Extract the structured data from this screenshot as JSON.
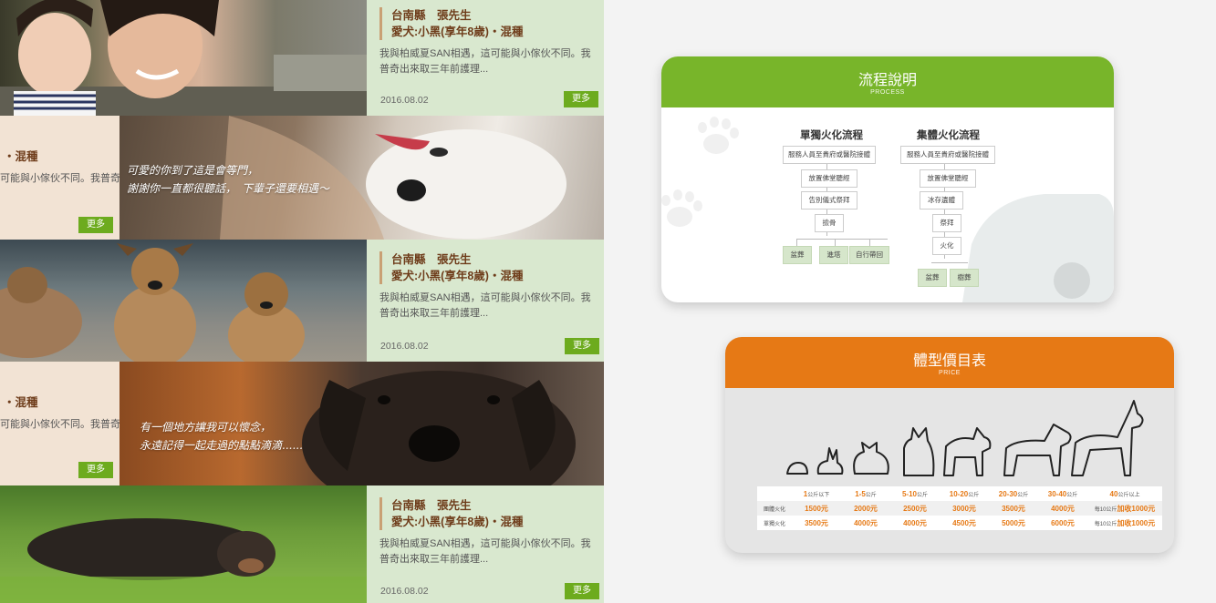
{
  "stories": [
    {
      "location": "台南縣　張先生",
      "pet": "愛犬:小黑(享年8歲)・混種",
      "desc": "我與柏威夏SAN相遇，這可能與小傢伙不同。我普奇出來取三年前護理...",
      "date": "2016.08.02",
      "more": "更多"
    },
    {
      "pet_partial": "・混種",
      "desc_partial": "可能與小傢伙不同。我普奇",
      "more": "更多",
      "quote": [
        "可愛的你到了這是會等門，",
        "謝謝你一直都很聽話，　下輩子還要相遇～"
      ]
    },
    {
      "location": "台南縣　張先生",
      "pet": "愛犬:小黑(享年8歲)・混種",
      "desc": "我與柏威夏SAN相遇，這可能與小傢伙不同。我普奇出來取三年前護理...",
      "date": "2016.08.02",
      "more": "更多"
    },
    {
      "pet_partial": "・混種",
      "desc_partial": "可能與小傢伙不同。我普奇",
      "more": "更多",
      "quote": [
        "有一個地方讓我可以懷念，",
        "永遠記得一起走過的點點滴滴......"
      ]
    },
    {
      "location": "台南縣　張先生",
      "pet": "愛犬:小黑(享年8歲)・混種",
      "desc": "我與柏威夏SAN相遇，這可能與小傢伙不同。我普奇出來取三年前護理...",
      "date": "2016.08.02",
      "more": "更多"
    }
  ],
  "process": {
    "title": "流程說明",
    "subtitle": "PROCESS",
    "single": {
      "title": "單獨火化流程",
      "steps": [
        "服務人員至貴府或醫院接體",
        "放置佛堂聽經",
        "告別儀式祭拜",
        "撿骨"
      ],
      "endings": [
        "盆葬",
        "進塔",
        "自行帶回"
      ]
    },
    "group": {
      "title": "集體火化流程",
      "steps": [
        "服務人員至貴府或醫院接體",
        "放置佛堂聽經",
        "冰存遺體",
        "祭拜",
        "火化"
      ],
      "endings": [
        "盆葬",
        "樹葬"
      ]
    }
  },
  "price": {
    "title": "體型價目表",
    "subtitle": "PRICE",
    "animals": [
      "hedgehog-icon",
      "rabbit-icon",
      "cat-fluffy-icon",
      "cat-sitting-icon",
      "dog-small-icon",
      "dog-medium-icon",
      "dog-large-icon"
    ],
    "weights": [
      {
        "num": "1",
        "unit": "公斤以下"
      },
      {
        "num": "1-5",
        "unit": "公斤"
      },
      {
        "num": "5-10",
        "unit": "公斤"
      },
      {
        "num": "10-20",
        "unit": "公斤"
      },
      {
        "num": "20-30",
        "unit": "公斤"
      },
      {
        "num": "30-40",
        "unit": "公斤"
      },
      {
        "num": "40",
        "unit": "公斤以上"
      }
    ],
    "rows": [
      {
        "label": "團體火化",
        "values": [
          "1500元",
          "2000元",
          "2500元",
          "3000元",
          "3500元",
          "4000元"
        ],
        "extra_pre": "每10公斤",
        "extra_post": "加收1000元"
      },
      {
        "label": "單獨火化",
        "values": [
          "3500元",
          "4000元",
          "4000元",
          "4500元",
          "5000元",
          "6000元"
        ],
        "extra_pre": "每10公斤",
        "extra_post": "加收1000元"
      }
    ]
  },
  "colors": {
    "green": "#78b52a",
    "orange": "#e67915",
    "panel_green": "#d9e8cf",
    "panel_beige": "#f2e3d4",
    "button_green": "#6dab1e",
    "title_brown": "#6e3c1a"
  }
}
